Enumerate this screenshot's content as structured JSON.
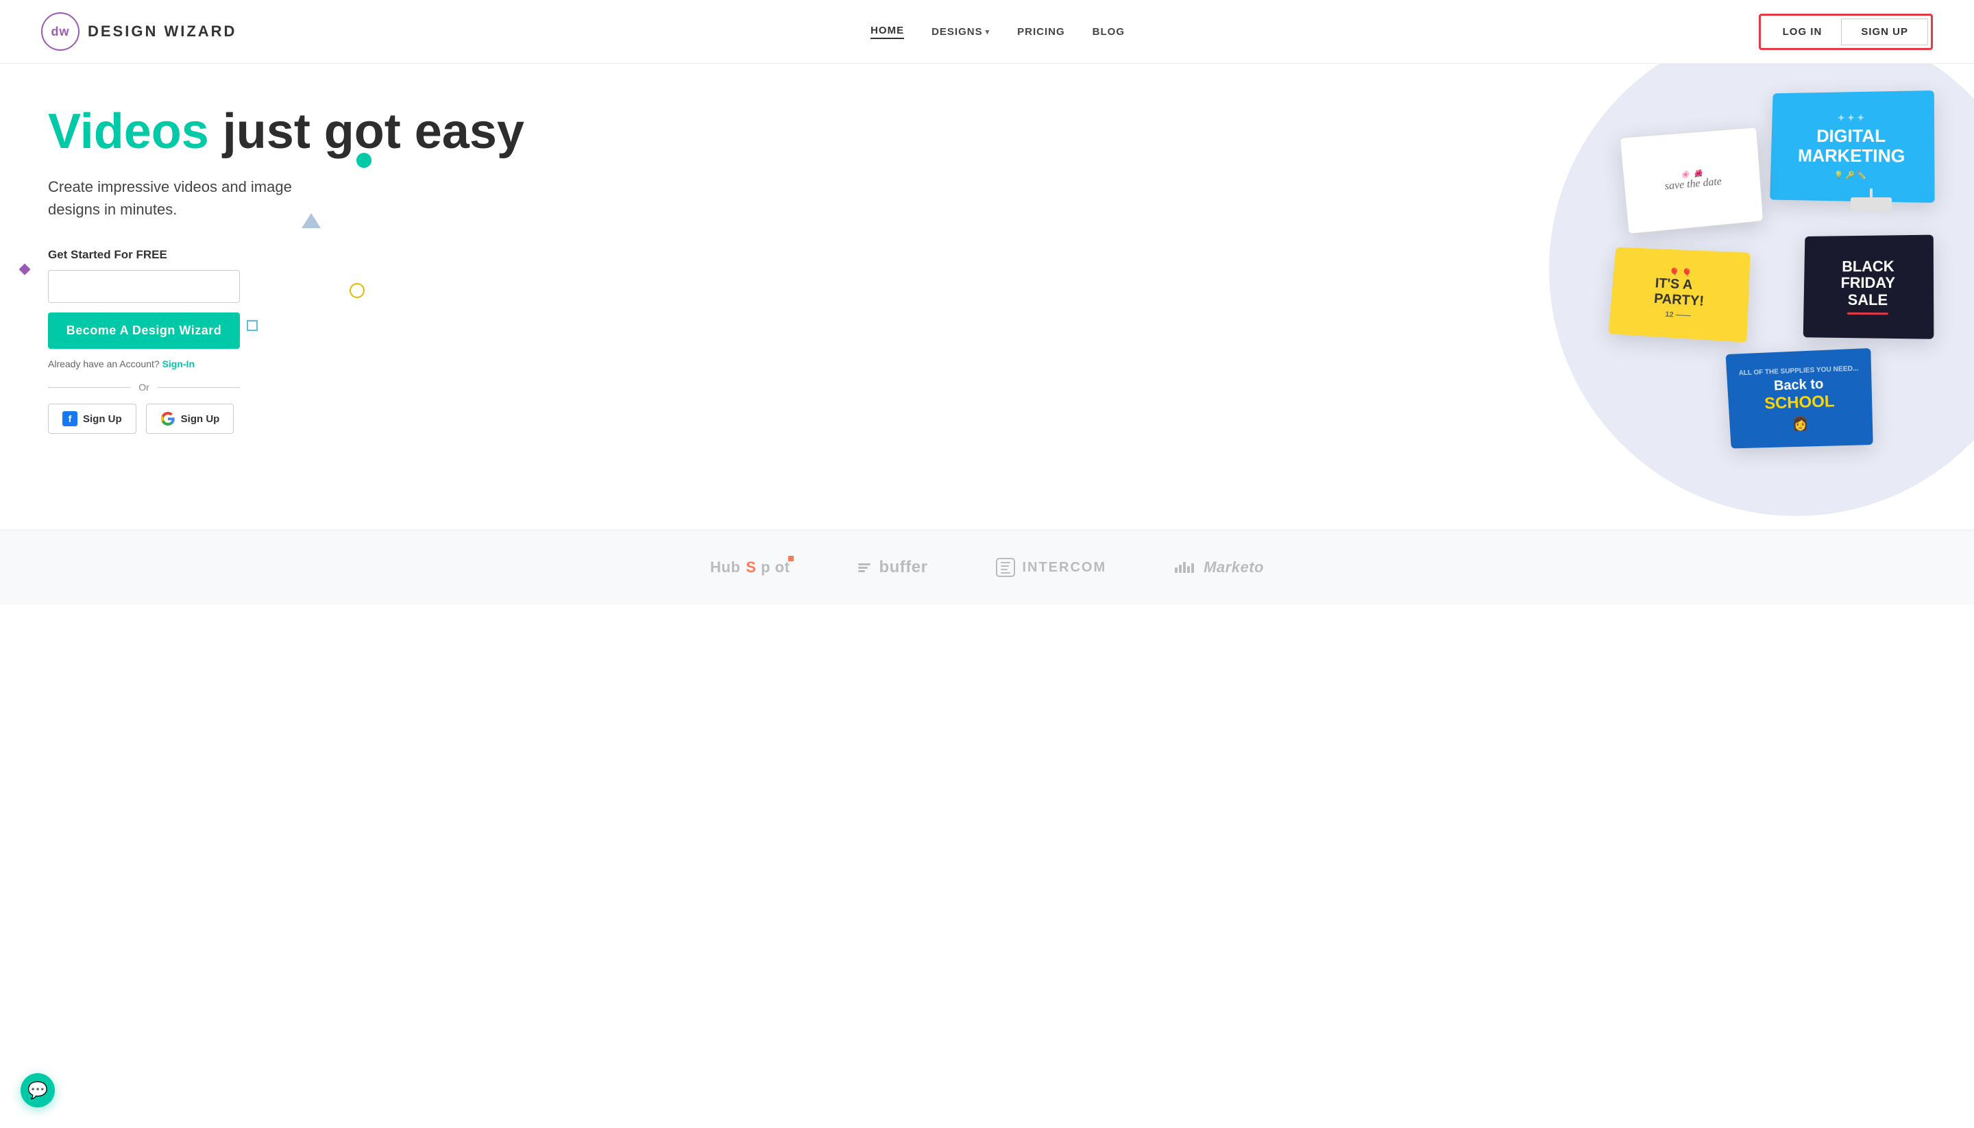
{
  "header": {
    "logo": {
      "letters": "dw",
      "brand_name": "DESIGN WIZARD"
    },
    "nav": {
      "items": [
        {
          "label": "HOME",
          "active": true
        },
        {
          "label": "DESIGNS",
          "has_dropdown": true
        },
        {
          "label": "PRICING",
          "active": false
        },
        {
          "label": "BLOG",
          "active": false
        }
      ]
    },
    "auth": {
      "login_label": "LOG IN",
      "signup_label": "SIGN UP"
    }
  },
  "hero": {
    "heading_colored": "Videos",
    "heading_rest": " just got easy",
    "subtitle": "Create impressive videos and image designs in minutes.",
    "form": {
      "get_started_label": "Get Started For FREE",
      "email_placeholder": "",
      "cta_button_label": "Become A Design Wizard",
      "already_account_text": "Already have an Account?",
      "sign_in_label": "Sign-In",
      "or_text": "Or",
      "facebook_signup": "Sign Up",
      "google_signup": "Sign Up"
    }
  },
  "cards": [
    {
      "id": "digital-marketing",
      "title": "DIGITAL\nMARKETING",
      "bg": "#29b6f6"
    },
    {
      "id": "save-date",
      "title": "save the date",
      "bg": "#ffffff"
    },
    {
      "id": "party",
      "title": "IT'S A\nPARTY!",
      "bg": "#fdd835"
    },
    {
      "id": "black-friday",
      "title": "BLACK\nFRIDAY\nSALE",
      "bg": "#1a1a2e"
    },
    {
      "id": "back-school",
      "title": "Back to\nSCHOOL",
      "bg": "#1565c0"
    }
  ],
  "brands": [
    {
      "name": "HubSpot",
      "id": "hubspot"
    },
    {
      "name": "buffer",
      "id": "buffer"
    },
    {
      "name": "INTERCOM",
      "id": "intercom"
    },
    {
      "name": "Marketo",
      "id": "marketo"
    }
  ],
  "chat": {
    "icon": "💬"
  }
}
